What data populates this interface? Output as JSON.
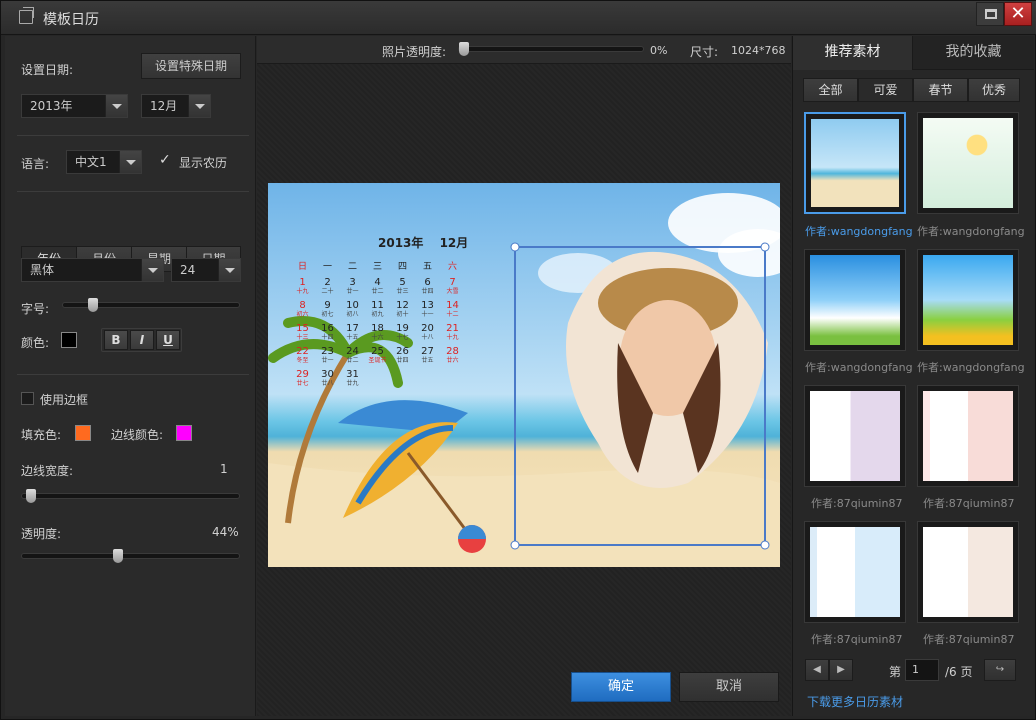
{
  "window": {
    "title": "模板日历"
  },
  "left": {
    "set_date_label": "设置日期:",
    "special_date_button": "设置特殊日期",
    "year_value": "2013年",
    "month_value": "12月",
    "language_label": "语言:",
    "language_value": "中文1",
    "show_lunar_label": "显示农历",
    "show_lunar_checked": true,
    "tabs": [
      {
        "label": "年份"
      },
      {
        "label": "月份"
      },
      {
        "label": "星期"
      },
      {
        "label": "日期"
      }
    ],
    "font_value": "黑体",
    "font_size_value": "24",
    "size_label": "字号:",
    "size_slider_fraction": 0.15,
    "color_label": "颜色:",
    "text_color": "#000000",
    "bold_label": "B",
    "italic_label": "I",
    "underline_label": "U",
    "use_border_label": "使用边框",
    "use_border_checked": false,
    "fill_color_label": "填充色:",
    "fill_color": "#ff6a1f",
    "border_color_label": "边线颜色:",
    "border_color": "#ff00ff",
    "border_width_label": "边线宽度:",
    "border_width_value": "1",
    "border_width_fraction": 0.02,
    "opacity_label": "透明度:",
    "opacity_value": "44%",
    "opacity_fraction": 0.44
  },
  "center": {
    "photo_opacity_label": "照片透明度:",
    "photo_opacity_value": "0%",
    "photo_opacity_fraction": 0.0,
    "size_label": "尺寸:",
    "size_value": "1024*768",
    "ok_button": "确定",
    "cancel_button": "取消",
    "calendar": {
      "title": "2013年　 12月",
      "weekdays": [
        "日",
        "一",
        "二",
        "三",
        "四",
        "五",
        "六"
      ],
      "rows": [
        [
          [
            "1",
            "十九"
          ],
          [
            "2",
            "二十"
          ],
          [
            "3",
            "廿一"
          ],
          [
            "4",
            "廿二"
          ],
          [
            "5",
            "廿三"
          ],
          [
            "6",
            "廿四"
          ],
          [
            "7",
            "大雪"
          ]
        ],
        [
          [
            "8",
            "初六"
          ],
          [
            "9",
            "初七"
          ],
          [
            "10",
            "初八"
          ],
          [
            "11",
            "初九"
          ],
          [
            "12",
            "初十"
          ],
          [
            "13",
            "十一"
          ],
          [
            "14",
            "十二"
          ]
        ],
        [
          [
            "15",
            "十三"
          ],
          [
            "16",
            "十四"
          ],
          [
            "17",
            "十五"
          ],
          [
            "18",
            "十六"
          ],
          [
            "19",
            "十七"
          ],
          [
            "20",
            "十八"
          ],
          [
            "21",
            "十九"
          ]
        ],
        [
          [
            "22",
            "冬至"
          ],
          [
            "23",
            "廿一"
          ],
          [
            "24",
            "廿二"
          ],
          [
            "25",
            "圣诞节"
          ],
          [
            "26",
            "廿四"
          ],
          [
            "27",
            "廿五"
          ],
          [
            "28",
            "廿六"
          ]
        ],
        [
          [
            "29",
            "廿七"
          ],
          [
            "30",
            "廿八"
          ],
          [
            "31",
            "廿九"
          ]
        ]
      ]
    }
  },
  "right": {
    "tab_recommended": "推荐素材",
    "tab_favorites": "我的收藏",
    "subtabs": [
      {
        "label": "全部"
      },
      {
        "label": "可爱"
      },
      {
        "label": "春节"
      },
      {
        "label": "优秀"
      }
    ],
    "thumbnails": [
      {
        "author": "作者:wangdongfang"
      },
      {
        "author": "作者:wangdongfang"
      },
      {
        "author": "作者:wangdongfang"
      },
      {
        "author": "作者:wangdongfang"
      },
      {
        "author": "作者:87qiumin87"
      },
      {
        "author": "作者:87qiumin87"
      },
      {
        "author": "作者:87qiumin87"
      },
      {
        "author": "作者:87qiumin87"
      }
    ],
    "page_label_prefix": "第",
    "page_value": "1",
    "page_label_suffix": "/6 页",
    "download_link": "下载更多日历素材"
  }
}
